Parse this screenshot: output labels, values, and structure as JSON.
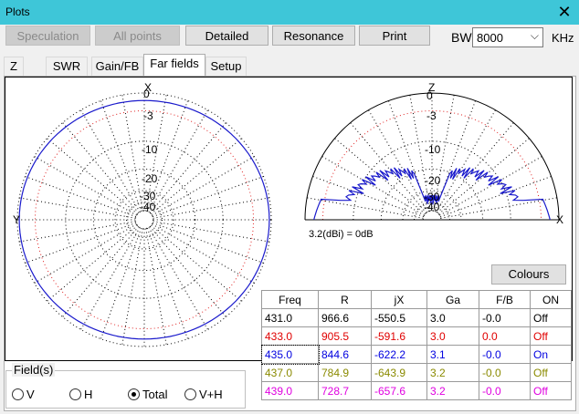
{
  "window": {
    "title": "Plots",
    "close": "✕"
  },
  "toolbar": {
    "speculation": "Speculation",
    "all_points": "All points",
    "detailed": "Detailed",
    "resonance": "Resonance",
    "print": "Print",
    "bw_label": "BW",
    "bw_value": "8000",
    "bw_unit": "KHz"
  },
  "tabs": [
    "Z",
    "SWR",
    "Gain/FB",
    "Far fields",
    "Setup"
  ],
  "active_tab": "Far fields",
  "plots": {
    "left": {
      "axis_top": "X",
      "axis_left": "Y",
      "rings": [
        "0",
        "-3",
        "-10",
        "-20",
        "-30",
        "-40"
      ]
    },
    "right": {
      "axis_top": "Z",
      "axis_right": "X",
      "rings": [
        "0",
        "-3",
        "-10",
        "-20",
        "-30",
        "-40"
      ],
      "reference": "3.2(dBi) = 0dB"
    },
    "trace_color": "#1a1acc",
    "ring_color": "#000000",
    "ref_ring_color": "#e02020"
  },
  "colours_button": "Colours",
  "table": {
    "headers": [
      "Freq",
      "R",
      "jX",
      "Ga",
      "F/B",
      "ON"
    ],
    "rows": [
      {
        "cells": [
          "431.0",
          "966.6",
          "-550.5",
          "3.0",
          "-0.0",
          "Off"
        ],
        "color": "#000000"
      },
      {
        "cells": [
          "433.0",
          "905.5",
          "-591.6",
          "3.0",
          "0.0",
          "Off"
        ],
        "color": "#e00000"
      },
      {
        "cells": [
          "435.0",
          "844.6",
          "-622.2",
          "3.1",
          "-0.0",
          "On"
        ],
        "color": "#0000e0"
      },
      {
        "cells": [
          "437.0",
          "784.9",
          "-643.9",
          "3.2",
          "-0.0",
          "Off"
        ],
        "color": "#8a8a00"
      },
      {
        "cells": [
          "439.0",
          "728.7",
          "-657.6",
          "3.2",
          "-0.0",
          "Off"
        ],
        "color": "#e000e0"
      }
    ]
  },
  "fields": {
    "legend": "Field(s)",
    "options": [
      "V",
      "H",
      "Total",
      "V+H"
    ],
    "selected": "Total"
  }
}
